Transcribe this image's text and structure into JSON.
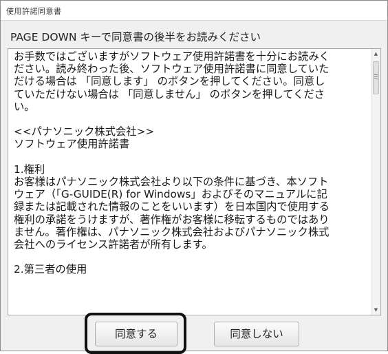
{
  "window": {
    "title": "使用許諾同意書"
  },
  "instruction": "PAGE DOWN キーで同意書の後半をお読みください",
  "license_lines": [
    "お手数ではございますがソフトウェア使用許諾書を十分にお読みく",
    "ださい。読み終わった後、ソフトウェア使用許諾書に同意していた",
    "だける場合は 「同意します」 のボタンを押してください。同意し",
    "ていただけない場合は 「同意しません」 のボタンを押してくださ",
    "い。",
    "",
    "<<パナソニック株式会社>>",
    "ソフトウェア使用許諾書",
    "",
    "1.権利",
    "お客様はパナソニック株式会社より以下の条件に基づき、本ソフト",
    "ウェア（「G-GUIDE(R) for Windows」およびそのマニュアルに記",
    "録または記載された情報のことをいいます）を日本国内で使用する",
    "権利の承諾をうけますが、著作権がお客様に移転するものではあり",
    "ません。著作権は、パナソニック株式会社およびパナソニック株式",
    "会社へのライセンス許諾者が所有します。",
    "",
    "2.第三者の使用"
  ],
  "buttons": {
    "agree": "同意する",
    "disagree": "同意しない"
  },
  "icons": {
    "scroll_up": "triangle-up",
    "scroll_down": "triangle-down"
  },
  "colors": {
    "highlight_frame": "#111111"
  }
}
